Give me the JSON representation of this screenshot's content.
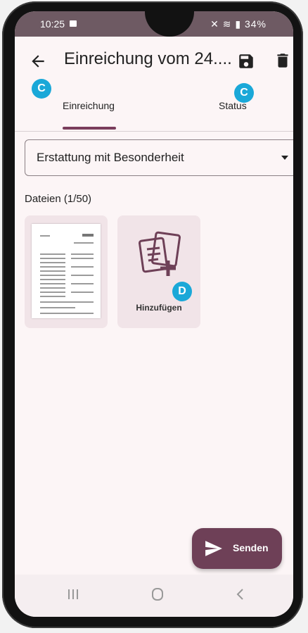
{
  "status_bar": {
    "time": "10:25",
    "battery": "34%"
  },
  "app_bar": {
    "title": "Einreichung vom 24...."
  },
  "tabs": [
    {
      "label": "Einreichung",
      "selected": true
    },
    {
      "label": "Status",
      "selected": false
    }
  ],
  "annotations": {
    "badge_c": "C",
    "badge_d": "D"
  },
  "dropdown": {
    "selected": "Erstattung mit Besonderheit"
  },
  "files": {
    "label": "Dateien (1/50)",
    "add_label": "Hinzufügen"
  },
  "fab": {
    "label": "Senden"
  },
  "colors": {
    "accent": "#7a3d5c",
    "fab": "#6e4057",
    "badge": "#1aa8d8",
    "card": "#f1e4e8"
  },
  "icons": [
    "back-arrow-icon",
    "save-icon",
    "delete-icon",
    "add-document-icon",
    "send-icon",
    "recents-icon",
    "home-icon",
    "nav-back-icon"
  ]
}
